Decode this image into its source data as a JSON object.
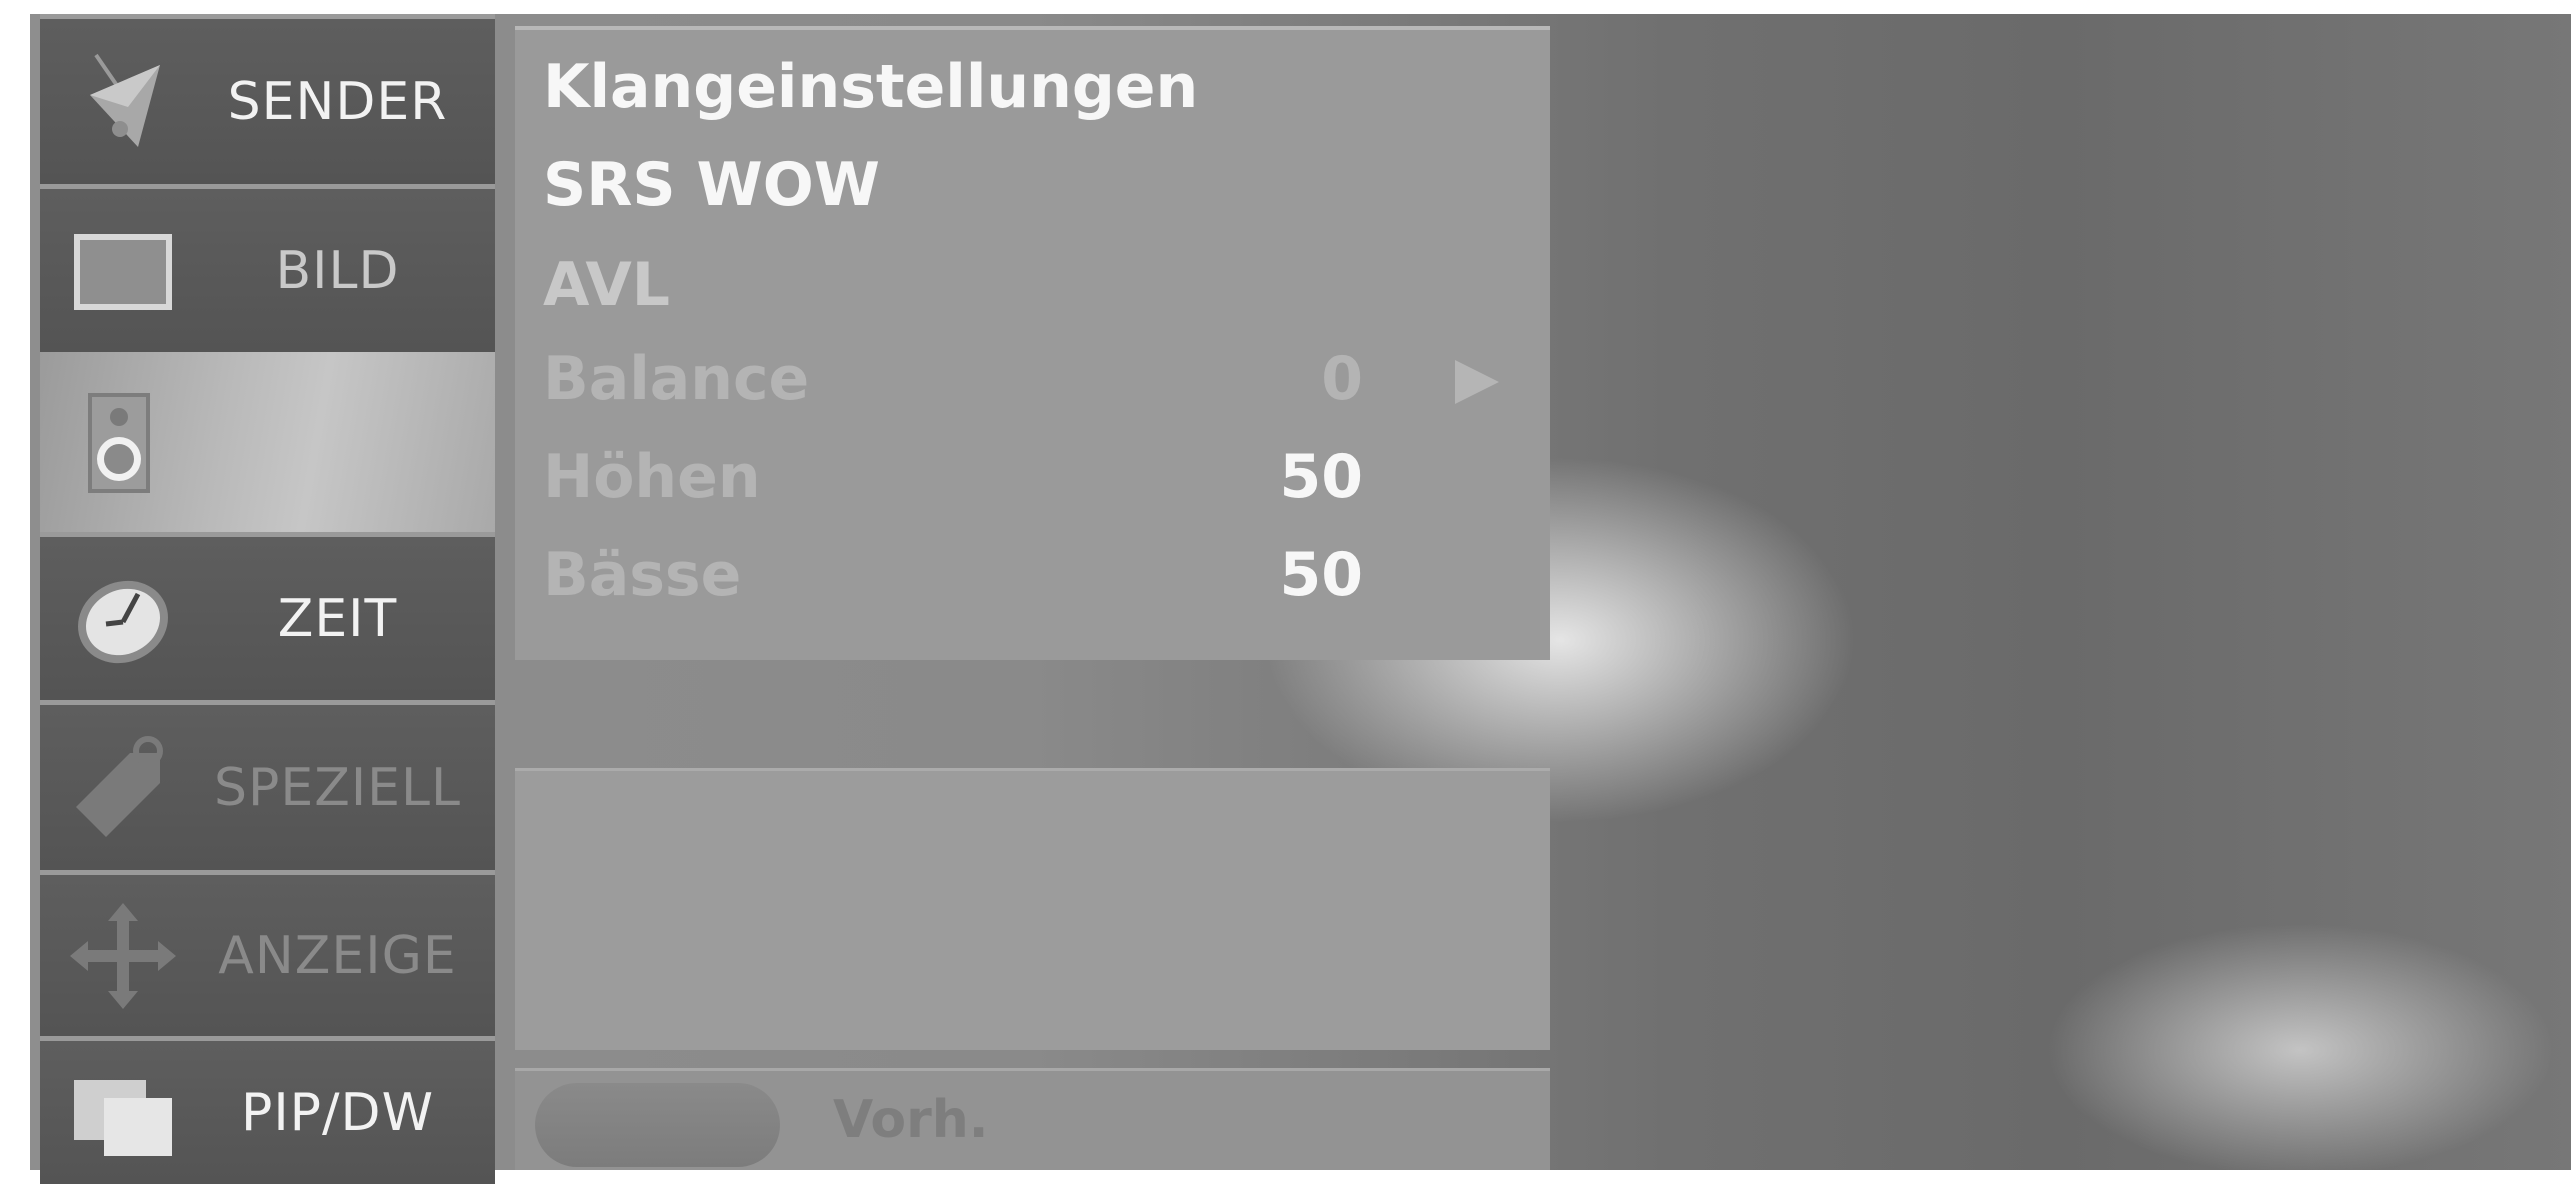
{
  "sidebar": {
    "items": [
      {
        "label": "SENDER",
        "icon": "satellite-dish-icon"
      },
      {
        "label": "BILD",
        "icon": "screen-icon"
      },
      {
        "label": "",
        "icon": "speaker-icon"
      },
      {
        "label": "ZEIT",
        "icon": "clock-icon"
      },
      {
        "label": "SPEZIELL",
        "icon": "tag-icon"
      },
      {
        "label": "ANZEIGE",
        "icon": "move-arrows-icon"
      },
      {
        "label": "PIP/DW",
        "icon": "pip-windows-icon"
      }
    ],
    "active_index": 2
  },
  "menu": {
    "rows": [
      {
        "label": "Klangeinstellungen",
        "value": ""
      },
      {
        "label": "SRS WOW",
        "value": ""
      },
      {
        "label": "AVL",
        "value": ""
      },
      {
        "label": "Balance",
        "value": "0"
      },
      {
        "label": "Höhen",
        "value": "50"
      },
      {
        "label": "Bässe",
        "value": "50"
      }
    ]
  },
  "footer": {
    "label": "Vorh."
  },
  "colors": {
    "sidebar_item": "#5a5a5a",
    "sidebar_active": "#b5b5b5",
    "panel": "#9a9a9a",
    "text_white": "#f7f7f7"
  }
}
